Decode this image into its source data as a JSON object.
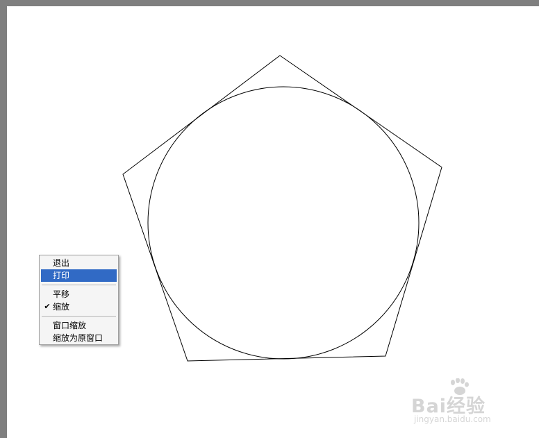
{
  "context_menu": {
    "items": [
      {
        "label": "退出",
        "checked": false,
        "highlighted": false
      },
      {
        "label": "打印",
        "checked": false,
        "highlighted": true
      },
      {
        "label": "平移",
        "checked": false,
        "highlighted": false
      },
      {
        "label": "缩放",
        "checked": true,
        "highlighted": false
      },
      {
        "label": "窗口缩放",
        "checked": false,
        "highlighted": false
      },
      {
        "label": "缩放为原窗口",
        "checked": false,
        "highlighted": false
      }
    ]
  },
  "watermark": {
    "main": "Bai经验",
    "sub": "jingyan.baidu.com"
  },
  "colors": {
    "background": "#7f7f7f",
    "canvas": "#ffffff",
    "highlight": "#316ac5",
    "menu_bg": "#f5f5f5",
    "stroke": "#000000"
  },
  "icons": {
    "check": "check-icon"
  }
}
